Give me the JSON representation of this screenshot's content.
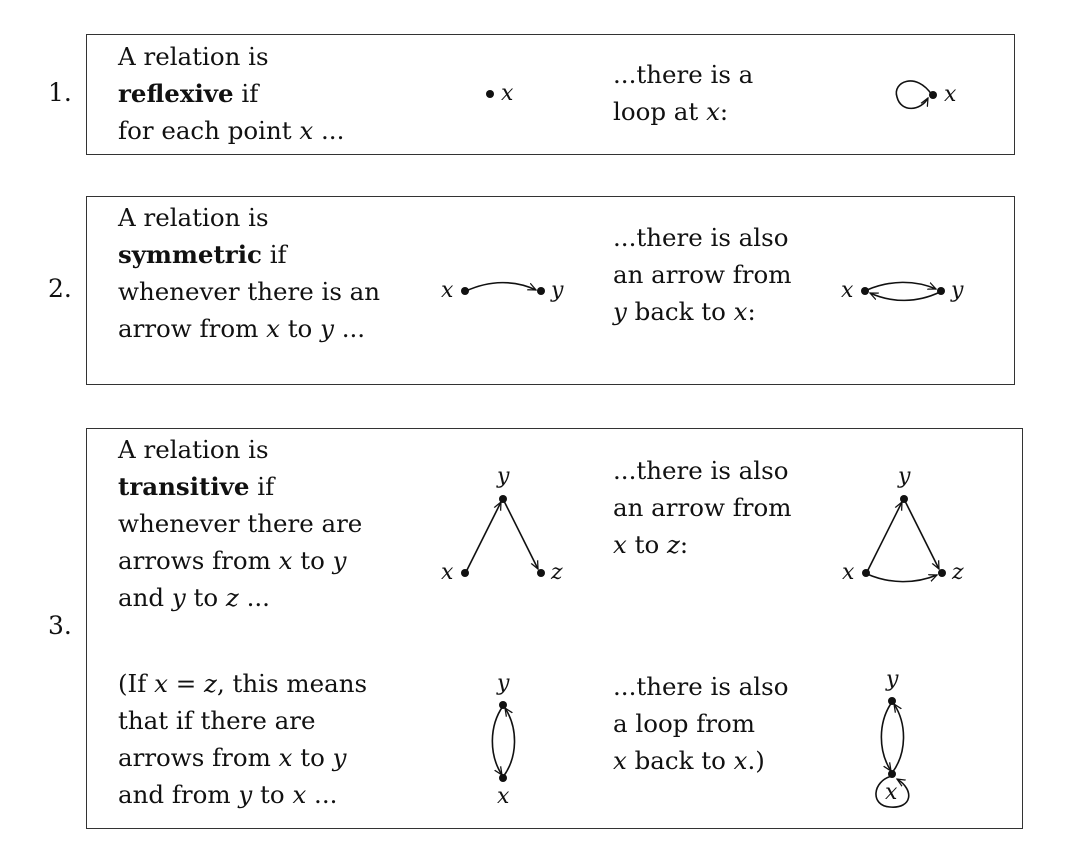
{
  "items": [
    {
      "number": "1.",
      "premise": {
        "l1": "A relation is",
        "term": "reflexive",
        "term_suffix": " if",
        "l3a": "for each point ",
        "l3v": "x",
        "l3b": " ..."
      },
      "conclusion": {
        "l1": "...there is a",
        "l2a": "loop at ",
        "l2v": "x",
        "l2b": ":"
      },
      "premise_fig": {
        "label_x": "x"
      },
      "conclusion_fig": {
        "label_x": "x"
      }
    },
    {
      "number": "2.",
      "premise": {
        "l1": "A relation is",
        "term": "symmetric",
        "term_suffix": " if",
        "l3": "whenever there is an",
        "l4a": "arrow from ",
        "l4v1": "x",
        "l4b": " to ",
        "l4v2": "y",
        "l4c": " ..."
      },
      "conclusion": {
        "l1": "...there is also",
        "l2": "an arrow from",
        "l3v1": "y",
        "l3a": " back to ",
        "l3v2": "x",
        "l3b": ":"
      },
      "premise_fig": {
        "label_x": "x",
        "label_y": "y"
      },
      "conclusion_fig": {
        "label_x": "x",
        "label_y": "y"
      }
    },
    {
      "number": "3.",
      "premise": {
        "l1": "A relation is",
        "term": "transitive",
        "term_suffix": " if",
        "l3": "whenever there are",
        "l4a": "arrows from ",
        "l4v1": "x",
        "l4b": " to ",
        "l4v2": "y",
        "l5a": "and ",
        "l5v1": "y",
        "l5b": " to ",
        "l5v2": "z",
        "l5c": " ..."
      },
      "conclusion": {
        "l1": "...there is also",
        "l2": "an arrow from",
        "l3v1": "x",
        "l3a": " to ",
        "l3v2": "z",
        "l3b": ":"
      },
      "premise_fig": {
        "label_x": "x",
        "label_y": "y",
        "label_z": "z"
      },
      "conclusion_fig": {
        "label_x": "x",
        "label_y": "y",
        "label_z": "z"
      },
      "special_premise": {
        "l1a": "(If ",
        "l1v1": "x",
        "l1b": " = ",
        "l1v2": "z",
        "l1c": ", this means",
        "l2": "that if there are",
        "l3a": "arrows from ",
        "l3v1": "x",
        "l3b": " to ",
        "l3v2": "y",
        "l4a": "and from ",
        "l4v1": "y",
        "l4b": " to ",
        "l4v2": "x",
        "l4c": " ..."
      },
      "special_conclusion": {
        "l1": "...there is also",
        "l2": "a loop from",
        "l3v1": "x",
        "l3a": " back to ",
        "l3v2": "x",
        "l3b": ".)"
      },
      "special_premise_fig": {
        "label_x": "x",
        "label_y": "y"
      },
      "special_conclusion_fig": {
        "label_x": "x",
        "label_y": "y"
      }
    }
  ]
}
